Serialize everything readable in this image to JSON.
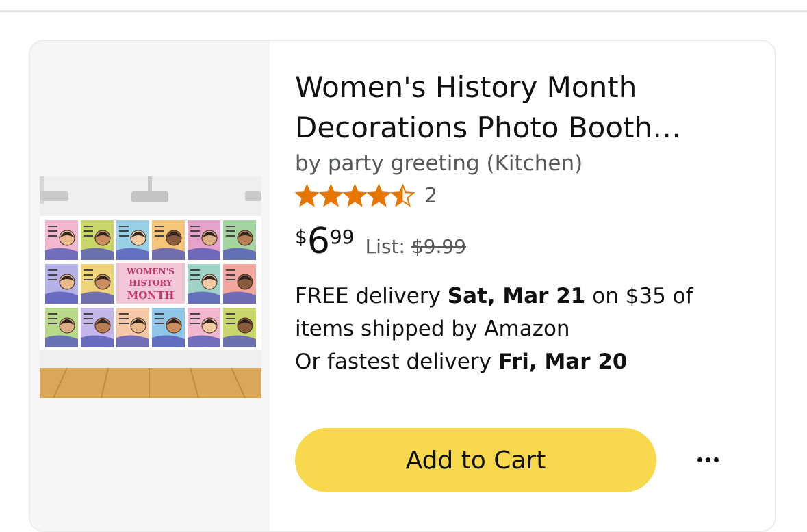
{
  "product": {
    "title_line1": "Women's History Month",
    "title_line2": "Decorations Photo Booth…",
    "brand": "by party greeting (Kitchen)",
    "rating": 4.5,
    "rating_max": 5,
    "rating_count": "2",
    "price": {
      "symbol": "$",
      "whole": "6",
      "fraction": "99",
      "list_label": "List:",
      "list_value": "$9.99"
    },
    "delivery": {
      "line1_prefix": "FREE delivery ",
      "line1_date": "Sat, Mar 21",
      "line1_suffix": " on $35 of",
      "line2": "items shipped by Amazon",
      "line3_prefix": "Or fastest delivery ",
      "line3_date": "Fri, Mar 20"
    },
    "image": {
      "banner_line1": "WOMEN'S",
      "banner_line2": "HISTORY",
      "banner_line3": "MONTH",
      "icon": "product-photo"
    }
  },
  "actions": {
    "add_to_cart_label": "Add to Cart",
    "more_icon": "more-dots-icon"
  },
  "colors": {
    "star": "#e77600",
    "button": "#f8d94e",
    "text": "#0f1111",
    "muted": "#565959"
  }
}
